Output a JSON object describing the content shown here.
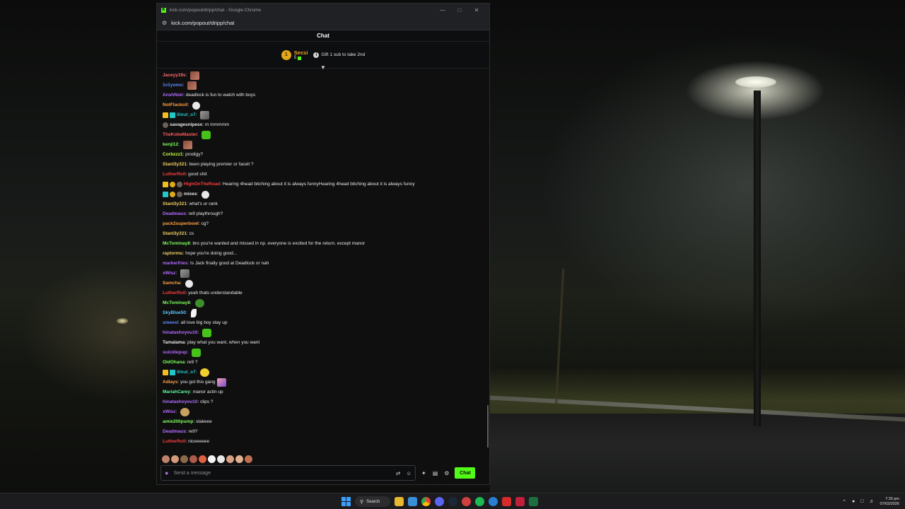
{
  "browser": {
    "window_title": "kick.com/popout/dripp/chat - Google Chrome",
    "url": "kick.com/popout/dripp/chat"
  },
  "chat": {
    "header": "Chat",
    "pinned_gifter": {
      "rank": "1",
      "name": "Secsi",
      "count": "5",
      "gift_text": "Gift 1 sub to take 2nd"
    },
    "messages": [
      {
        "user": "Jaceyy19s",
        "color": "#ff6b6b",
        "badges": [],
        "text": "",
        "emotes": [
          "pic"
        ]
      },
      {
        "user": "1v1yomo",
        "color": "#5b8cff",
        "badges": [],
        "text": "",
        "emotes": [
          "pic"
        ]
      },
      {
        "user": "AnshNoir",
        "color": "#b46bff",
        "badges": [],
        "text": "deadlock is fun to watch with boys",
        "emotes": []
      },
      {
        "user": "NotFlackoX",
        "color": "#ffa040",
        "badges": [],
        "text": "",
        "emotes": [
          "ghost"
        ]
      },
      {
        "user": "lilnut_o7",
        "color": "#23c7c7",
        "badges": [
          "crown",
          "gift"
        ],
        "text": "",
        "emotes": [
          "cat"
        ]
      },
      {
        "user": "savagesnipesx",
        "color": "#e8e8e8",
        "badges": [
          "avatar"
        ],
        "text": "m mmmmm",
        "emotes": []
      },
      {
        "user": "TheKobeMaster",
        "color": "#ff5a5a",
        "badges": [],
        "text": "",
        "emotes": [
          "green"
        ]
      },
      {
        "user": "kenji12",
        "color": "#7cff5a",
        "badges": [],
        "text": "",
        "emotes": [
          "pic"
        ]
      },
      {
        "user": "Corbzzz1",
        "color": "#c8ff40",
        "badges": [],
        "text": "prodigy?",
        "emotes": []
      },
      {
        "user": "Stanl3y321",
        "color": "#f0d060",
        "badges": [],
        "text": "been playing premier or faceit ?",
        "emotes": []
      },
      {
        "user": "LutherRoll",
        "color": "#ff3b3b",
        "badges": [],
        "text": "good shit",
        "emotes": []
      },
      {
        "user": "HighOnTheRoad",
        "color": "#ff3b3b",
        "badges": [
          "crown",
          "coin",
          "avatar"
        ],
        "text": "Hearing 4head bitching about it is always funnyHearing 4head bitching about it is always funny",
        "emotes": []
      },
      {
        "user": "mixes",
        "color": "#e8e8e8",
        "badges": [
          "gift",
          "coin",
          "avatar"
        ],
        "text": "",
        "emotes": [
          "ghost"
        ]
      },
      {
        "user": "Stanl3y321",
        "color": "#f0d060",
        "badges": [],
        "text": "what's ur rank",
        "emotes": []
      },
      {
        "user": "Deadmaus",
        "color": "#b46bff",
        "badges": [],
        "text": "re9 playthrough?",
        "emotes": []
      },
      {
        "user": "pack2superbowl",
        "color": "#ffa040",
        "badges": [],
        "text": "cg?",
        "emotes": []
      },
      {
        "user": "Stanl3y321",
        "color": "#f0d060",
        "badges": [],
        "text": "cs",
        "emotes": []
      },
      {
        "user": "McTominay8",
        "color": "#7cff5a",
        "badges": [],
        "text": "bro you're wanted and missed in np. everyone is excited for the return. except manor",
        "emotes": []
      },
      {
        "user": "raptormu",
        "color": "#f0d060",
        "badges": [],
        "text": "hope you're doing good...",
        "emotes": []
      },
      {
        "user": "markerfries",
        "color": "#b46bff",
        "badges": [],
        "text": "Is Jack finally good at Deadlock or nah",
        "emotes": []
      },
      {
        "user": "xWisz",
        "color": "#b46bff",
        "badges": [],
        "text": "",
        "emotes": [
          "cat"
        ]
      },
      {
        "user": "Samcha",
        "color": "#ffa040",
        "badges": [],
        "text": "",
        "emotes": [
          "ghost"
        ]
      },
      {
        "user": "LutherRoll",
        "color": "#ff3b3b",
        "badges": [],
        "text": "yeah thats understandable",
        "emotes": []
      },
      {
        "user": "McTominay8",
        "color": "#7cff5a",
        "badges": [],
        "text": "",
        "emotes": [
          "frog"
        ]
      },
      {
        "user": "SkyBlue50",
        "color": "#5bc8ff",
        "badges": [],
        "text": "",
        "emotes": [
          "feather"
        ]
      },
      {
        "user": "smeesl",
        "color": "#5b8cff",
        "badges": [],
        "text": "all love big boy stay up",
        "emotes": []
      },
      {
        "user": "hinatashoyou10",
        "color": "#b46bff",
        "badges": [],
        "text": "",
        "emotes": [
          "green"
        ]
      },
      {
        "user": "Tamalama",
        "color": "#e8e8e8",
        "badges": [],
        "text": "play what you want, when you want",
        "emotes": []
      },
      {
        "user": "suicidepup",
        "color": "#b46bff",
        "badges": [],
        "text": "",
        "emotes": [
          "green"
        ]
      },
      {
        "user": "OldOhana",
        "color": "#7cff5a",
        "badges": [],
        "text": "re9 ?",
        "emotes": []
      },
      {
        "user": "lilnut_o7",
        "color": "#23c7c7",
        "badges": [
          "crown",
          "gift"
        ],
        "text": "",
        "emotes": [
          "yellow"
        ]
      },
      {
        "user": "Adlays",
        "color": "#ffa040",
        "badges": [],
        "text": "you got this gang",
        "emotes": [
          "cartoon"
        ]
      },
      {
        "user": "MariahCarey",
        "color": "#5bff9a",
        "badges": [],
        "text": "manor actin up",
        "emotes": []
      },
      {
        "user": "hinatashoyou10",
        "color": "#b46bff",
        "badges": [],
        "text": "clips ?",
        "emotes": []
      },
      {
        "user": "xWisz",
        "color": "#b46bff",
        "badges": [],
        "text": "",
        "emotes": [
          "dog"
        ]
      },
      {
        "user": "amie200pump",
        "color": "#7cff5a",
        "badges": [],
        "text": "stakeee",
        "emotes": []
      },
      {
        "user": "Deadmaus",
        "color": "#b46bff",
        "badges": [],
        "text": "re9?",
        "emotes": []
      },
      {
        "user": "LutherRoll",
        "color": "#ff3b3b",
        "badges": [],
        "text": "niceeeeee",
        "emotes": []
      }
    ],
    "quick_emotes": [
      "#c0806a",
      "#d49a7a",
      "#8a6a4a",
      "#b05a4a",
      "#e06040",
      "#f4f4f4",
      "#e8e8e8",
      "#d8a080",
      "#e0b090",
      "#c07050"
    ],
    "input": {
      "placeholder": "Send a message"
    },
    "send_label": "Chat"
  },
  "taskbar": {
    "search_label": "Search",
    "time": "7:30 pm",
    "date": "07/03/2026",
    "apps": [
      "file-explorer",
      "photos",
      "chrome",
      "discord",
      "steam",
      "ccleaner",
      "spotify",
      "edge-beta",
      "app-red",
      "app-red-2",
      "excel"
    ]
  },
  "colors": {
    "kick_green": "#53fc18",
    "gifter_gold": "#f5a623"
  }
}
